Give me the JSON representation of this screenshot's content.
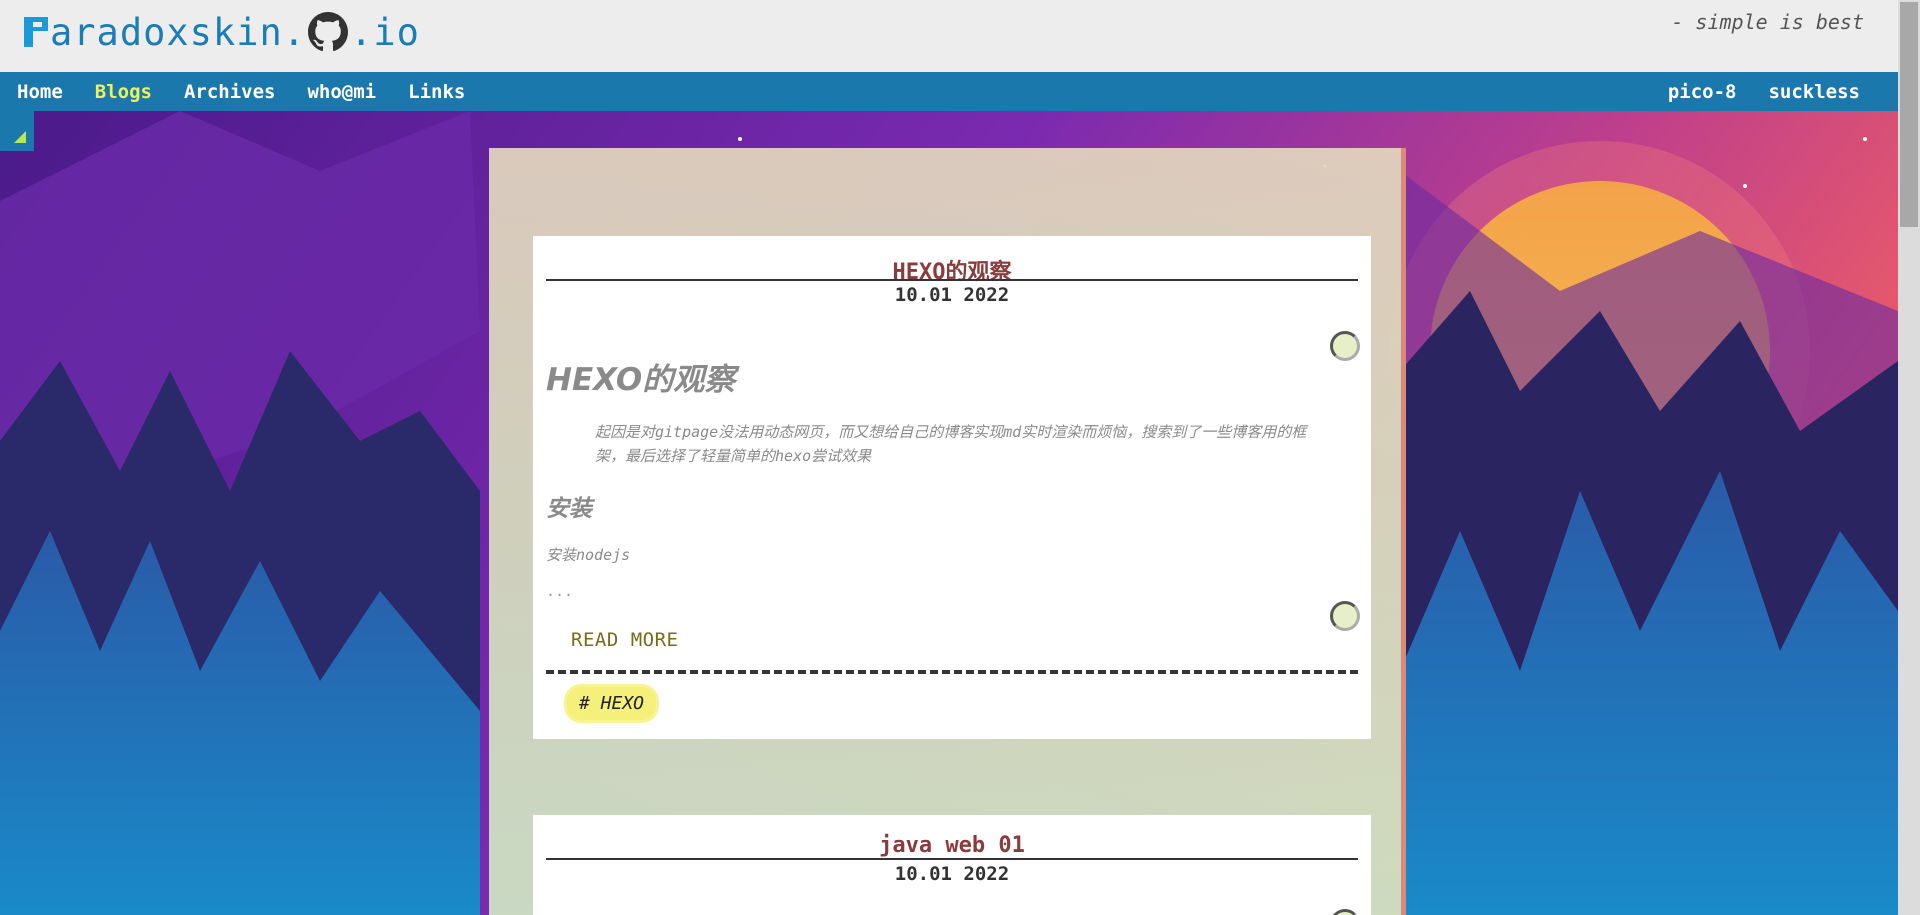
{
  "header": {
    "logo_text": "aradoxskin.",
    "logo_suffix": ".io",
    "tagline": "- simple is best"
  },
  "nav": {
    "left": [
      "Home",
      "Blogs",
      "Archives",
      "who@mi",
      "Links"
    ],
    "active": "Blogs",
    "right": [
      "pico-8",
      "suckless"
    ]
  },
  "posts": [
    {
      "title": "HEXO的观察",
      "date": "10.01 2022",
      "heading": "HEXO的观察",
      "quote": "起因是对gitpage没法用动态网页，而又想给自己的博客实现md实时渲染而烦恼，搜索到了一些博客用的框架，最后选择了轻量简单的hexo尝试效果",
      "subheading": "安装",
      "paragraph": "安装nodejs",
      "ellipsis": "...",
      "read_more": "READ MORE",
      "tag": "# HEXO"
    },
    {
      "title": "java web 01",
      "date": "10.01 2022"
    }
  ],
  "colors": {
    "nav_bg": "#1a78ac",
    "nav_active": "#e9f35a",
    "title_color": "#8b3b3b",
    "tag_bg": "#f4f07a"
  }
}
